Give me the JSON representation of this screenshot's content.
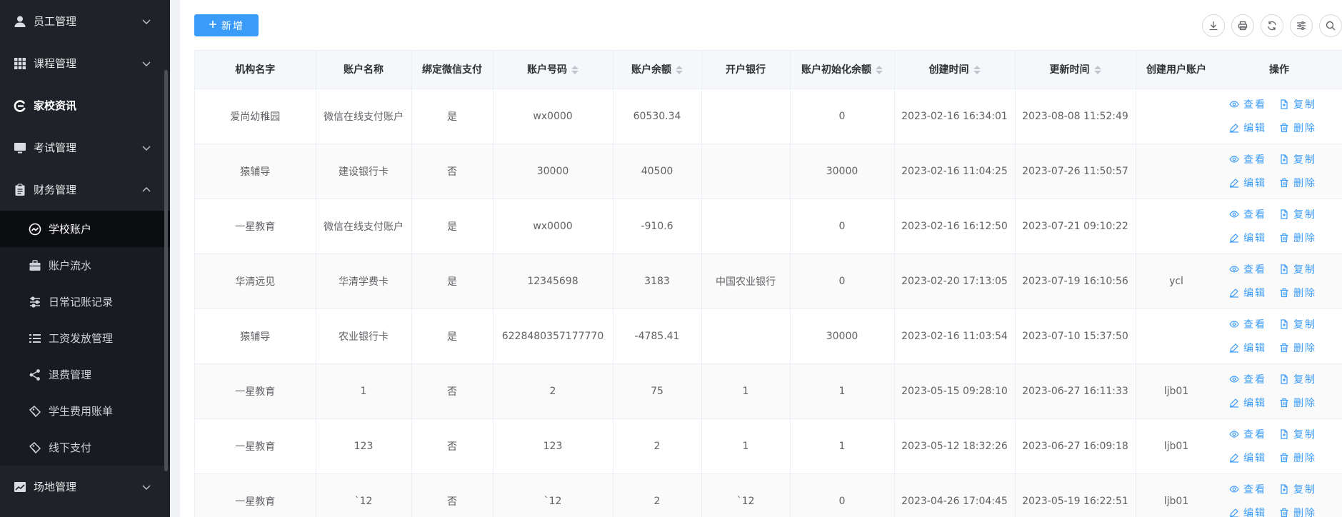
{
  "sidebar": {
    "items": [
      {
        "label": "员工管理",
        "icon": "user-icon",
        "chevron": "down"
      },
      {
        "label": "课程管理",
        "icon": "grid-icon",
        "chevron": "down"
      },
      {
        "label": "家校资讯",
        "icon": "e-logo-icon",
        "chevron": ""
      },
      {
        "label": "考试管理",
        "icon": "monitor-icon",
        "chevron": "down"
      },
      {
        "label": "财务管理",
        "icon": "clipboard-icon",
        "chevron": "up"
      }
    ],
    "sub_items": [
      {
        "label": "学校账户",
        "icon": "smile-circle-icon",
        "active": true
      },
      {
        "label": "账户流水",
        "icon": "briefcase-icon"
      },
      {
        "label": "日常记账记录",
        "icon": "sliders-icon"
      },
      {
        "label": "工资发放管理",
        "icon": "list-icon"
      },
      {
        "label": "退费管理",
        "icon": "share-icon"
      },
      {
        "label": "学生费用账单",
        "icon": "tag-icon"
      },
      {
        "label": "线下支付",
        "icon": "tag-icon"
      }
    ],
    "bottom_item": {
      "label": "场地管理",
      "icon": "chart-icon",
      "chevron": "down"
    }
  },
  "toolbar": {
    "add_label": "新增",
    "icons": [
      "download-icon",
      "print-icon",
      "refresh-icon",
      "filter-icon",
      "search-icon"
    ]
  },
  "table": {
    "columns": [
      "机构名字",
      "账户名称",
      "绑定微信支付",
      "账户号码",
      "账户余额",
      "开户银行",
      "账户初始化余额",
      "创建时间",
      "更新时间",
      "创建用户账户",
      "操作"
    ],
    "rows": [
      [
        "爱尚幼稚园",
        "微信在线支付账户",
        "是",
        "wx0000",
        "60530.34",
        "",
        "0",
        "2023-02-16 16:34:01",
        "2023-08-08 11:52:49",
        ""
      ],
      [
        "猿辅导",
        "建设银行卡",
        "否",
        "30000",
        "40500",
        "",
        "30000",
        "2023-02-16 11:04:25",
        "2023-07-26 11:50:57",
        ""
      ],
      [
        "一星教育",
        "微信在线支付账户",
        "是",
        "wx0000",
        "-910.6",
        "",
        "0",
        "2023-02-16 16:12:50",
        "2023-07-21 09:10:22",
        ""
      ],
      [
        "华清远见",
        "华清学费卡",
        "是",
        "12345698",
        "3183",
        "中国农业银行",
        "0",
        "2023-02-20 17:13:05",
        "2023-07-19 16:10:56",
        "ycl"
      ],
      [
        "猿辅导",
        "农业银行卡",
        "是",
        "6228480357177770",
        "-4785.41",
        "",
        "30000",
        "2023-02-16 11:03:54",
        "2023-07-10 15:37:50",
        ""
      ],
      [
        "一星教育",
        "1",
        "否",
        "2",
        "75",
        "1",
        "1",
        "2023-05-15 09:28:10",
        "2023-06-27 16:11:33",
        "ljb01"
      ],
      [
        "一星教育",
        "123",
        "否",
        "123",
        "2",
        "1",
        "1",
        "2023-05-12 18:32:26",
        "2023-06-27 16:09:18",
        "ljb01"
      ],
      [
        "一星教育",
        "`12",
        "否",
        "`12",
        "2",
        "`12",
        "0",
        "2023-04-26 17:04:45",
        "2023-05-19 16:22:51",
        "ljb01"
      ]
    ],
    "actions": {
      "view": "查看",
      "copy": "复制",
      "edit": "编辑",
      "delete": "删除"
    }
  },
  "colors": {
    "sidebar_bg": "#1f2329",
    "accent": "#3a9bf8",
    "header_bg": "#f5f7fa"
  }
}
